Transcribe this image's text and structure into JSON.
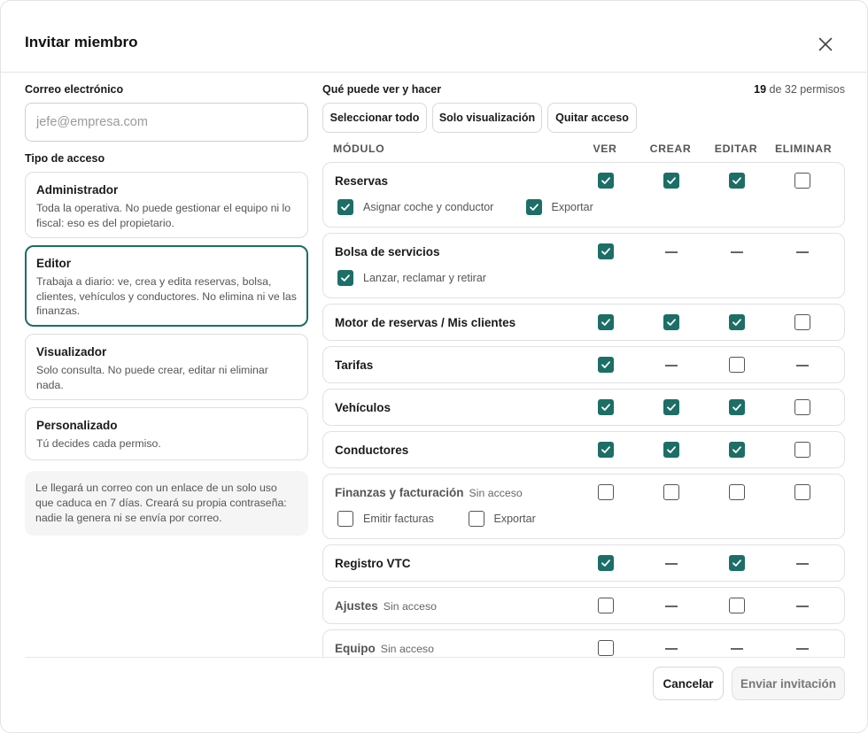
{
  "dialog": {
    "title": "Invitar miembro"
  },
  "email": {
    "label": "Correo electrónico",
    "placeholder": "jefe@empresa.com",
    "value": ""
  },
  "access": {
    "label": "Tipo de acceso",
    "roles": [
      {
        "name": "Administrador",
        "desc": "Toda la operativa. No puede gestionar el equipo ni lo fiscal: eso es del propietario."
      },
      {
        "name": "Editor",
        "desc": "Trabaja a diario: ve, crea y edita reservas, bolsa, clientes, vehículos y conductores. No elimina ni ve las finanzas.",
        "selected": true
      },
      {
        "name": "Visualizador",
        "desc": "Solo consulta. No puede crear, editar ni eliminar nada."
      },
      {
        "name": "Personalizado",
        "desc": "Tú decides cada permiso."
      }
    ],
    "note": "Le llegará un correo con un enlace de un solo uso que caduca en 7 días. Creará su propia contraseña: nadie la genera ni se envía por correo."
  },
  "permissions": {
    "title": "Qué puede ver y hacer",
    "count_selected": "19",
    "count_rest": " de 32 permisos",
    "buttons": {
      "select_all": "Seleccionar todo",
      "view_only": "Solo visualización",
      "remove": "Quitar acceso"
    },
    "columns": {
      "module": "MÓDULO",
      "view": "VER",
      "create": "CREAR",
      "edit": "EDITAR",
      "delete": "ELIMINAR"
    },
    "no_access": "Sin acceso",
    "modules": [
      {
        "name": "Reservas",
        "perms": [
          "on",
          "on",
          "on",
          "off"
        ],
        "subs": [
          {
            "label": "Asignar coche y conductor",
            "state": "on"
          },
          {
            "label": "Exportar",
            "state": "on"
          }
        ]
      },
      {
        "name": "Bolsa de servicios",
        "perms": [
          "on",
          "na",
          "na",
          "na"
        ],
        "subs": [
          {
            "label": "Lanzar, reclamar y retirar",
            "state": "on"
          }
        ]
      },
      {
        "name": "Motor de reservas / Mis clientes",
        "perms": [
          "on",
          "on",
          "on",
          "off"
        ]
      },
      {
        "name": "Tarifas",
        "perms": [
          "on",
          "na",
          "off",
          "na"
        ]
      },
      {
        "name": "Vehículos",
        "perms": [
          "on",
          "on",
          "on",
          "off"
        ]
      },
      {
        "name": "Conductores",
        "perms": [
          "on",
          "on",
          "on",
          "off"
        ]
      },
      {
        "name": "Finanzas y facturación",
        "no_access": true,
        "perms": [
          "off",
          "off",
          "off",
          "off"
        ],
        "subs": [
          {
            "label": "Emitir facturas",
            "state": "off"
          },
          {
            "label": "Exportar",
            "state": "off"
          }
        ]
      },
      {
        "name": "Registro VTC",
        "perms": [
          "on",
          "na",
          "on",
          "na"
        ]
      },
      {
        "name": "Ajustes",
        "no_access": true,
        "perms": [
          "off",
          "na",
          "off",
          "na"
        ]
      },
      {
        "name": "Equipo",
        "no_access": true,
        "perms": [
          "off",
          "na",
          "na",
          "na"
        ]
      }
    ]
  },
  "footer": {
    "cancel": "Cancelar",
    "send": "Enviar invitación"
  },
  "colors": {
    "accent": "#1c6e66"
  }
}
